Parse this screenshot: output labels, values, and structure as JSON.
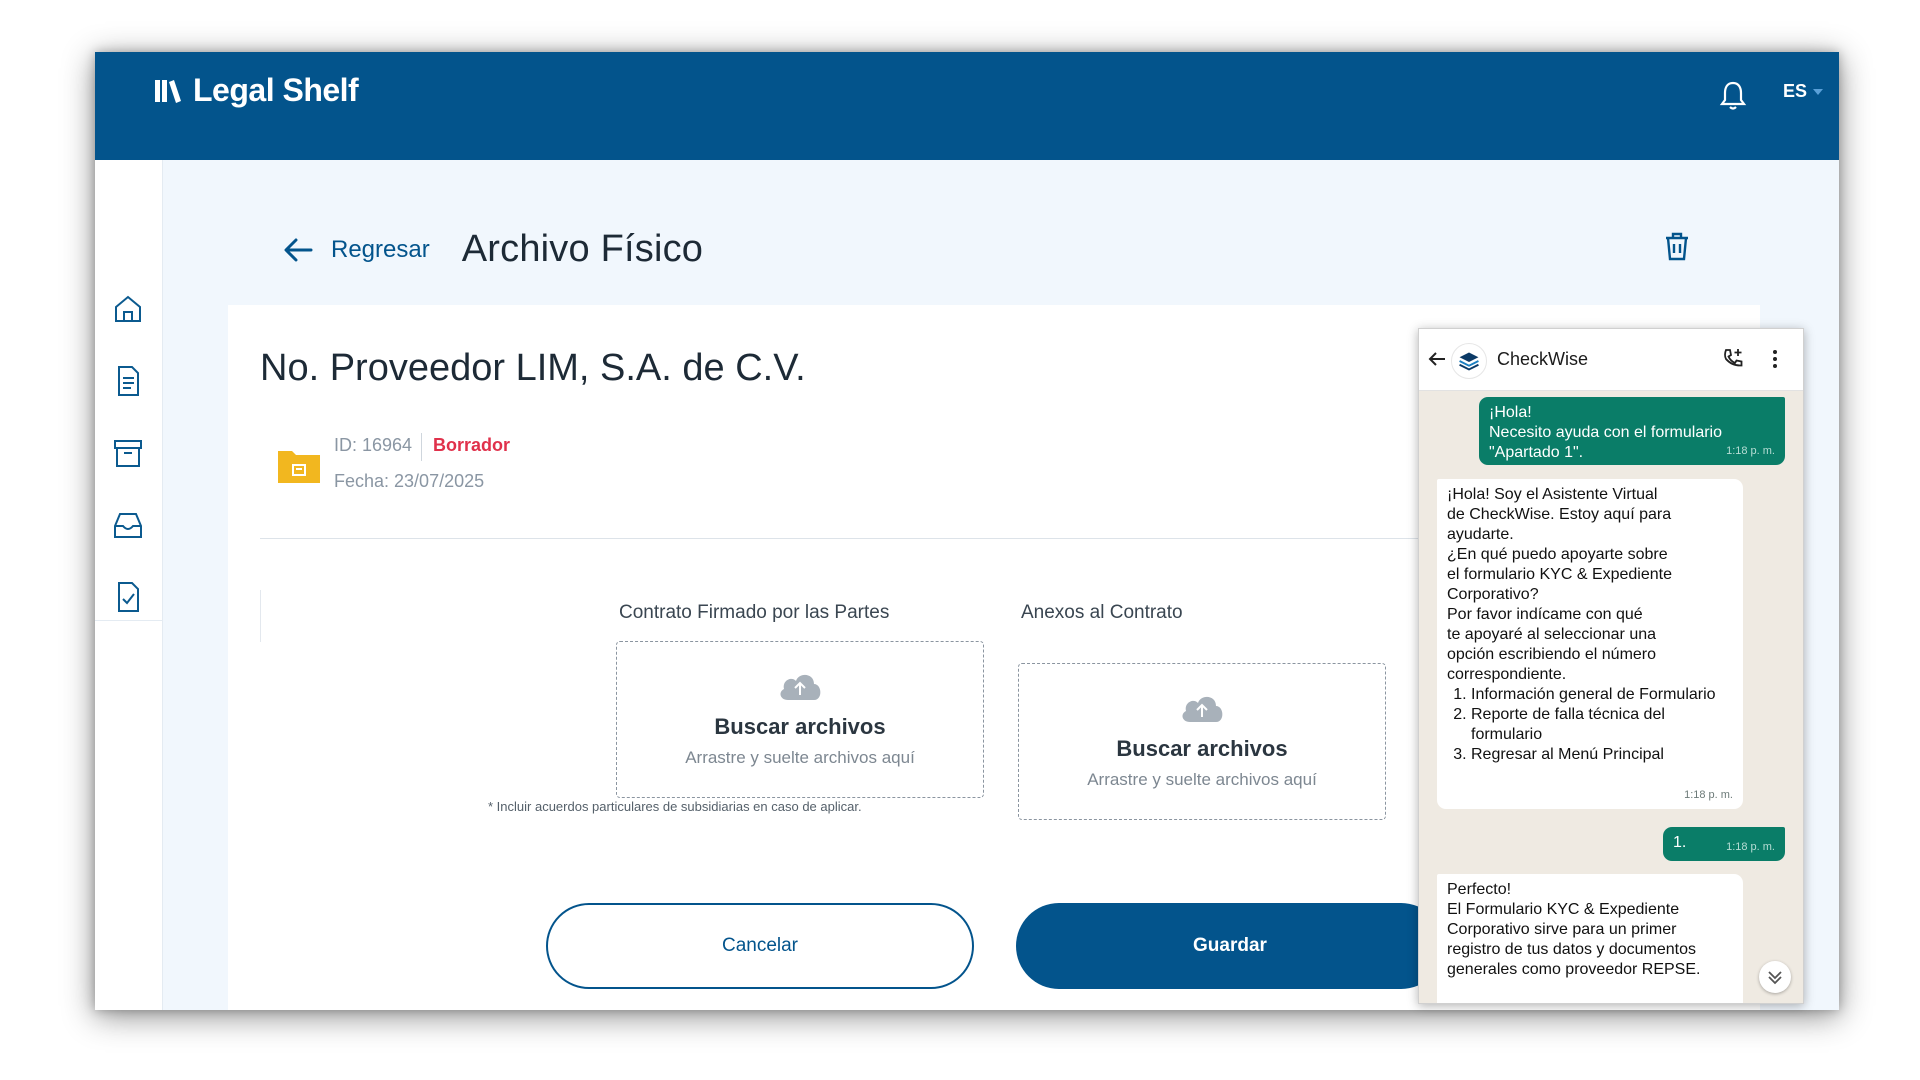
{
  "app": {
    "name": "Legal Shelf",
    "language": "ES"
  },
  "nav": {
    "back_label": "Regresar",
    "page_title": "Archivo Físico"
  },
  "record": {
    "supplier": "No. Proveedor LIM, S.A. de C.V.",
    "id_text": "ID: 16964",
    "status": "Borrador",
    "date_text": "Fecha: 23/07/2025"
  },
  "uploads": [
    {
      "label": "Contrato Firmado por las Partes",
      "title": "Buscar archivos",
      "subtitle": "Arrastre y suelte archivos aquí"
    },
    {
      "label": "Anexos al Contrato",
      "title": "Buscar archivos",
      "subtitle": "Arrastre y suelte archivos aquí"
    }
  ],
  "note": "* Incluir acuerdos particulares de subsidiarias en caso de aplicar.",
  "actions": {
    "cancel": "Cancelar",
    "save": "Guardar"
  },
  "chat": {
    "contact": "CheckWise",
    "messages": [
      {
        "from": "user",
        "lines": [
          "¡Hola!",
          "Necesito ayuda con el formulario",
          "\"Apartado 1\"."
        ],
        "time": "1:18 p. m."
      },
      {
        "from": "bot",
        "lines": [
          "¡Hola! Soy el Asistente Virtual",
          "de CheckWise. Estoy aquí para",
          "ayudarte.",
          "¿En qué puedo apoyarte sobre",
          "el formulario KYC & Expediente",
          "Corporativo?",
          "Por favor indícame con qué",
          "te apoyaré al seleccionar una",
          "opción escribiendo el número",
          "correspondiente."
        ],
        "options": [
          "Información general de Formulario",
          "Reporte de falla técnica del formulario",
          "Regresar al Menú Principal"
        ],
        "time": "1:18 p. m."
      },
      {
        "from": "user",
        "lines": [
          "1."
        ],
        "time": "1:18 p. m."
      },
      {
        "from": "bot",
        "lines": [
          "Perfecto!",
          "El Formulario KYC & Expediente",
          "Corporativo sirve para un primer",
          "registro de tus datos y documentos",
          "generales como proveedor REPSE."
        ]
      }
    ]
  },
  "colors": {
    "brand": "#03548c",
    "status_draft": "#e0314b",
    "chat_out": "#0a7d68",
    "folder": "#f2b71f"
  }
}
